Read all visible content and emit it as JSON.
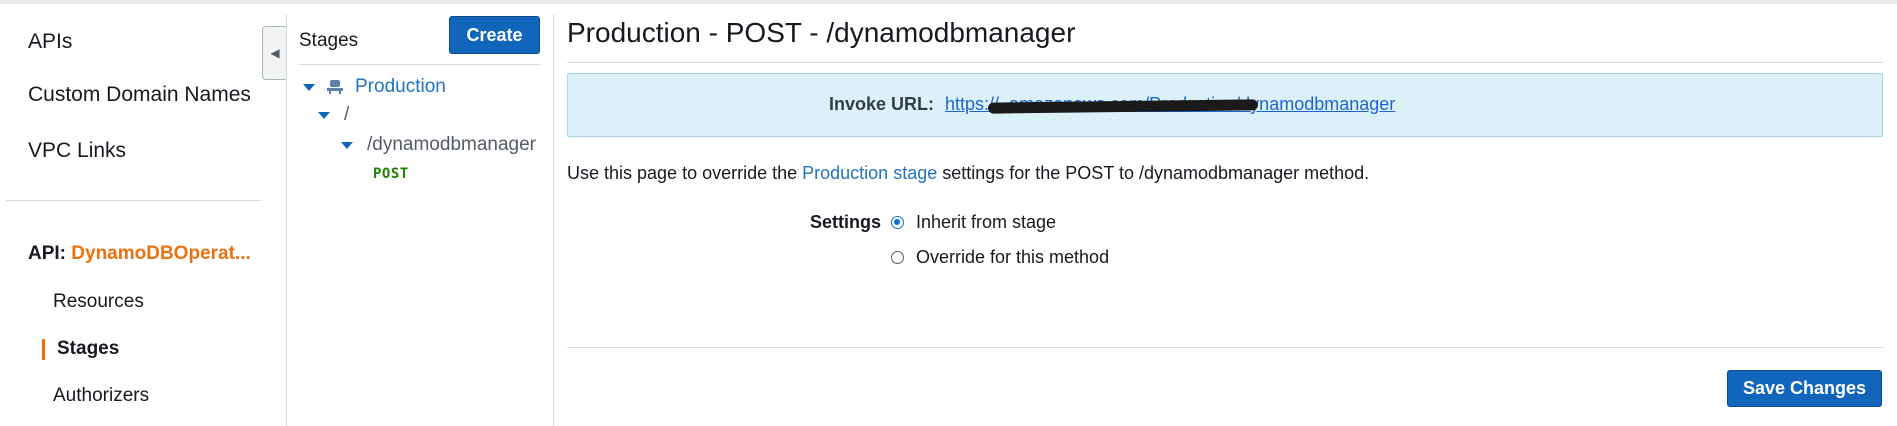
{
  "nav": {
    "items": [
      {
        "label": "APIs"
      },
      {
        "label": "Custom Domain Names"
      },
      {
        "label": "VPC Links"
      }
    ],
    "api": {
      "prefix": "API:",
      "name": "DynamoDBOperat..."
    },
    "sub_items": [
      {
        "label": "Resources"
      },
      {
        "label": "Stages"
      },
      {
        "label": "Authorizers"
      }
    ],
    "collapse_icon": "◀"
  },
  "stages": {
    "title": "Stages",
    "create_label": "Create",
    "tree": {
      "stage": "Production",
      "root": "/",
      "resource": "/dynamodbmanager",
      "method": "POST"
    }
  },
  "main": {
    "title": "Production - POST - /dynamodbmanager",
    "invoke_label": "Invoke URL:",
    "invoke_url": "https://                                                           .amazonaws.com/Production/dynamodbmanager",
    "desc_pre": "Use this page to override the ",
    "desc_link": "Production stage",
    "desc_post": " settings for the POST to /dynamodbmanager method.",
    "settings_label": "Settings",
    "radio_inherit": "Inherit from stage",
    "radio_override": "Override for this method",
    "selected": "inherit",
    "save_label": "Save Changes"
  },
  "colors": {
    "primary": "#1166bb",
    "accent": "#ec7211",
    "link": "#2074c1",
    "method": "#1d8102",
    "info_bg": "#dcf0f8"
  }
}
